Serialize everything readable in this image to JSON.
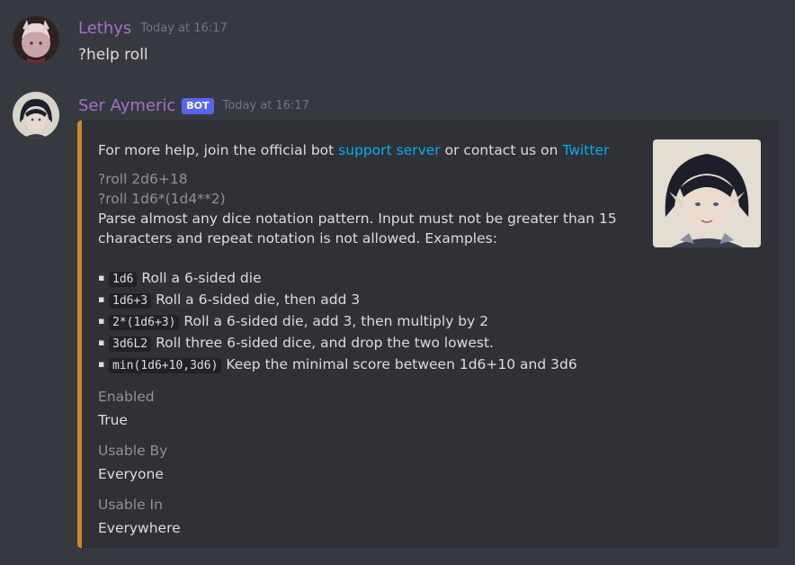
{
  "messages": [
    {
      "author": "Lethys",
      "timestamp": "Today at 16:17",
      "text": "?help roll"
    },
    {
      "author": "Ser Aymeric",
      "badge": "BOT",
      "timestamp": "Today at 16:17"
    }
  ],
  "embed": {
    "accent_color": "#c98a2b",
    "intro_prefix": "For more help, join the official bot",
    "intro_link1": "support server",
    "intro_middle": "or contact us on",
    "intro_link2": "Twitter",
    "usage_line1": "?roll 2d6+18",
    "usage_line2": "?roll 1d6*(1d4**2)",
    "description": "Parse almost any dice notation pattern. Input must not be greater than 15 characters and repeat notation is not allowed. Examples:",
    "examples": [
      {
        "code": "1d6",
        "text": "Roll a 6-sided die"
      },
      {
        "code": "1d6+3",
        "text": "Roll a 6-sided die, then add 3"
      },
      {
        "code": "2*(1d6+3)",
        "text": "Roll a 6-sided die, add 3, then multiply by 2"
      },
      {
        "code": "3d6L2",
        "text": "Roll three 6-sided dice, and drop the two lowest."
      },
      {
        "code": "min(1d6+10,3d6)",
        "text": "Keep the minimal score between 1d6+10 and 3d6"
      }
    ],
    "fields": [
      {
        "name": "Enabled",
        "value": "True"
      },
      {
        "name": "Usable By",
        "value": "Everyone"
      },
      {
        "name": "Usable In",
        "value": "Everywhere"
      }
    ]
  },
  "colors": {
    "background": "#36393f",
    "embed_background": "#2f3136",
    "link": "#00aff4",
    "author_name": "#a56fc7",
    "bot_badge": "#5865f2"
  }
}
